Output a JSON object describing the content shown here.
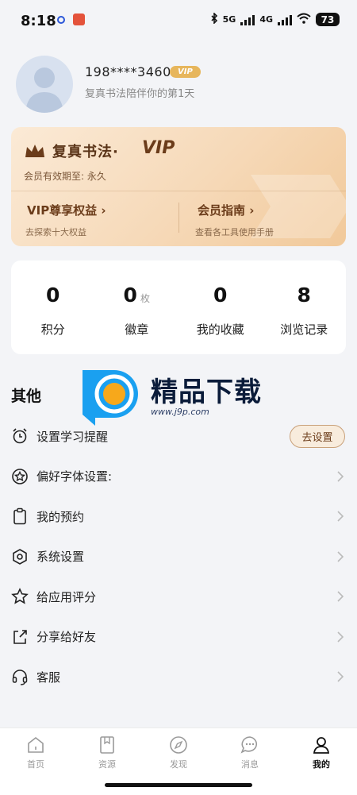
{
  "status_bar": {
    "time": "8:18",
    "net1": "5G",
    "net2": "4G",
    "battery": "73"
  },
  "profile": {
    "phone": "198****3460",
    "vip_badge": "VIP",
    "subtitle": "复真书法陪伴你的第1天"
  },
  "vip_card": {
    "title": "复真书法·",
    "tag": "VIP",
    "expire": "会员有效期至: 永久",
    "left_link": "VIP尊享权益",
    "left_sub": "去探索十大权益",
    "right_link": "会员指南",
    "right_sub": "查看各工具使用手册"
  },
  "stats": [
    {
      "value": "0",
      "unit": "",
      "label": "积分"
    },
    {
      "value": "0",
      "unit": "枚",
      "label": "徽章"
    },
    {
      "value": "0",
      "unit": "",
      "label": "我的收藏"
    },
    {
      "value": "8",
      "unit": "",
      "label": "浏览记录"
    }
  ],
  "section_title": "其他",
  "menu": [
    {
      "label": "设置学习提醒",
      "icon": "alarm-icon",
      "action": "去设置"
    },
    {
      "label": "偏好字体设置:",
      "icon": "star-circle-icon"
    },
    {
      "label": "我的预约",
      "icon": "clipboard-icon"
    },
    {
      "label": "系统设置",
      "icon": "hexagon-settings-icon"
    },
    {
      "label": "给应用评分",
      "icon": "star-icon"
    },
    {
      "label": "分享给好友",
      "icon": "share-icon"
    },
    {
      "label": "客服",
      "icon": "headset-icon"
    }
  ],
  "watermark": {
    "text": "精品下载",
    "url": "www.j9p.com"
  },
  "tabs": [
    {
      "label": "首页",
      "icon": "home-icon"
    },
    {
      "label": "资源",
      "icon": "bookmark-icon"
    },
    {
      "label": "发现",
      "icon": "compass-icon"
    },
    {
      "label": "消息",
      "icon": "chat-icon"
    },
    {
      "label": "我的",
      "icon": "user-icon",
      "active": true
    }
  ],
  "colors": {
    "accent": "#6b3c1a",
    "vip_gold": "#e7b65c",
    "background": "#f3f4f7"
  }
}
